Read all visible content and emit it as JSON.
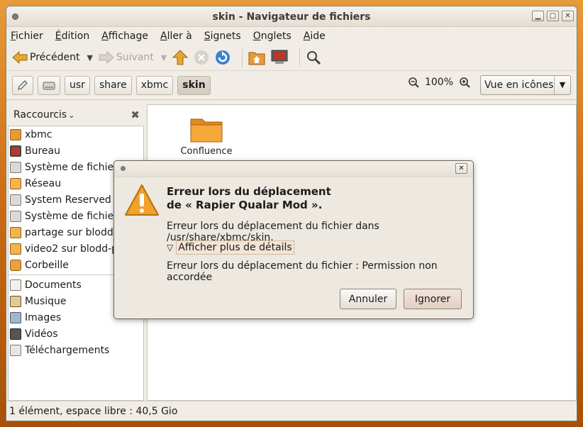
{
  "window": {
    "title": "skin - Navigateur de fichiers"
  },
  "menu": [
    {
      "pre": "",
      "ul": "F",
      "post": "ichier"
    },
    {
      "pre": "",
      "ul": "É",
      "post": "dition"
    },
    {
      "pre": "",
      "ul": "A",
      "post": "ffichage"
    },
    {
      "pre": "",
      "ul": "A",
      "post": "ller à"
    },
    {
      "pre": "",
      "ul": "S",
      "post": "ignets"
    },
    {
      "pre": "",
      "ul": "O",
      "post": "nglets"
    },
    {
      "pre": "",
      "ul": "A",
      "post": "ide"
    }
  ],
  "toolbar": {
    "back_label": "Précédent",
    "forward_label": "Suivant"
  },
  "path": {
    "crumbs": [
      "usr",
      "share",
      "xbmc",
      "skin"
    ],
    "active": "skin"
  },
  "zoom": {
    "level": "100%"
  },
  "view": {
    "selected": "Vue en icônes"
  },
  "sidebar": {
    "header": "Raccourcis",
    "places": [
      "xbmc",
      "Bureau",
      "Système de fichiers",
      "Réseau",
      "System Reserved",
      "Système de fichier...",
      "partage sur blodd-pc",
      "video2 sur blodd-pc",
      "Corbeille"
    ],
    "bookmarks": [
      "Documents",
      "Musique",
      "Images",
      "Vidéos",
      "Téléchargements"
    ]
  },
  "files": [
    {
      "name": "Confluence",
      "icon": "folder-icon"
    }
  ],
  "status": {
    "text": "1 élément, espace libre : 40,5 Gio"
  },
  "dialog": {
    "heading_line1": "Erreur lors du déplacement",
    "heading_line2": "de « Rapier Qualar Mod ».",
    "message": "Erreur lors du déplacement du fichier dans /usr/share/xbmc/skin.",
    "details_toggle": "Afficher plus de détails",
    "detail": "Erreur lors du déplacement du fichier : Permission non accordée",
    "cancel_label": "Annuler",
    "ignore_label": "Ignorer"
  },
  "colors": {
    "accent": "#f07746",
    "folder": "#f0a030",
    "desktop": "#d98a2b"
  }
}
